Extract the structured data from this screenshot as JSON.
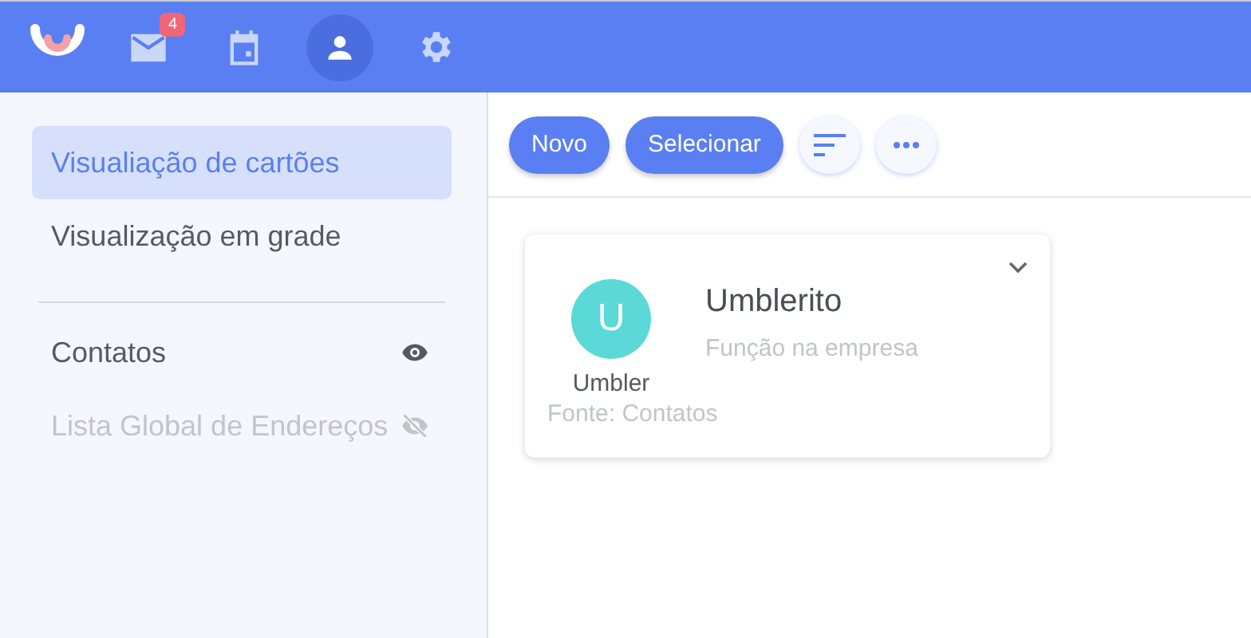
{
  "nav": {
    "items": [
      {
        "kind": "mail",
        "selected": false,
        "badge": "4"
      },
      {
        "kind": "calendar",
        "selected": false
      },
      {
        "kind": "contacts",
        "selected": true
      },
      {
        "kind": "settings",
        "selected": false
      }
    ]
  },
  "sidebar": {
    "views": [
      {
        "label": "Visualiação de cartões",
        "selected": true
      },
      {
        "label": "Visualização em grade",
        "selected": false
      }
    ],
    "sources": [
      {
        "label": "Contatos",
        "visible": true
      },
      {
        "label": "Lista Global de Endereços",
        "visible": false
      }
    ]
  },
  "toolbar": {
    "buttons": [
      {
        "kind": "text",
        "label": "Novo"
      },
      {
        "kind": "text",
        "label": "Selecionar"
      },
      {
        "kind": "sort"
      },
      {
        "kind": "more"
      }
    ]
  },
  "cards": [
    {
      "initial": "U",
      "color": "#5bd9d9",
      "company": "Umbler",
      "name": "Umblerito",
      "role": "Função na empresa",
      "source": "Fonte: Contatos"
    }
  ]
}
